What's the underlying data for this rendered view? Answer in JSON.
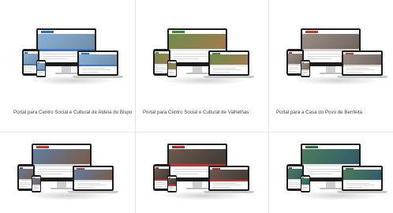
{
  "portfolio": {
    "items": [
      {
        "caption": "Portal para Centro Social e Cultural de Aldeia do Bispo",
        "colors": {
          "accent": "#2f6fb3",
          "photo": "#8bb0d6",
          "photo2": "#6f8fa8",
          "band": "#3b78c0"
        }
      },
      {
        "caption": "Portal para Centro Social e Cultural de Valhelhas",
        "colors": {
          "accent": "#3a8a3a",
          "photo": "#6c8d4a",
          "photo2": "#a57a4e",
          "band": "#e8e8e8"
        }
      },
      {
        "caption": "Portal para a Casa do Povo de Benfeita",
        "colors": {
          "accent": "#c23b2b",
          "photo": "#9a8f85",
          "photo2": "#6f6660",
          "band": "#d9d2c9"
        }
      },
      {
        "caption": "",
        "colors": {
          "accent": "#c0392b",
          "photo": "#5e7ea3",
          "photo2": "#7c5b45",
          "band": "#d9d9d9"
        }
      },
      {
        "caption": "",
        "colors": {
          "accent": "#b3262c",
          "photo": "#6b5a4d",
          "photo2": "#3f3a35",
          "band": "#c9302c"
        }
      },
      {
        "caption": "",
        "colors": {
          "accent": "#2c6e3f",
          "photo": "#4f7d5a",
          "photo2": "#2f5a6b",
          "band": "#e7ece8"
        }
      }
    ]
  }
}
